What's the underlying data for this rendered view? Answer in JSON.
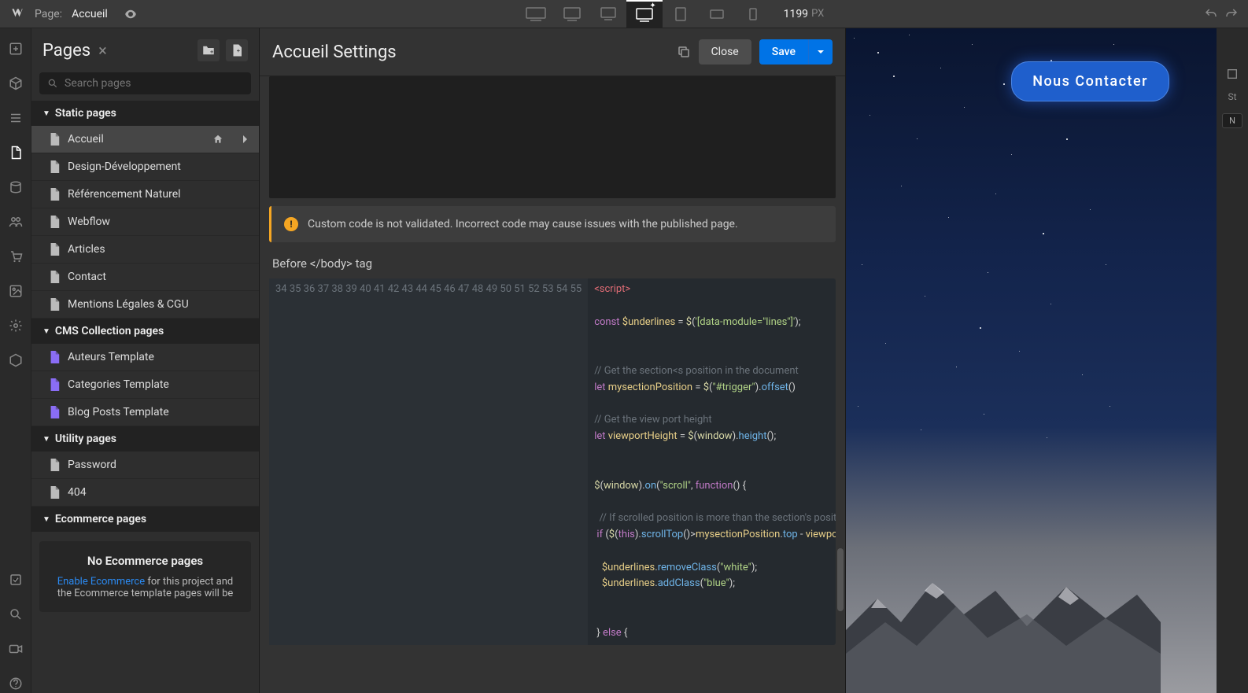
{
  "topbar": {
    "page_label": "Page:",
    "page_name": "Accueil",
    "width_value": "1199",
    "width_unit": "PX"
  },
  "pages_panel": {
    "title": "Pages",
    "search_placeholder": "Search pages",
    "sections": {
      "static": "Static pages",
      "cms": "CMS Collection pages",
      "utility": "Utility pages",
      "ecommerce": "Ecommerce pages"
    },
    "static_pages": [
      "Accueil",
      "Design-Développement",
      "Référencement Naturel",
      "Webflow",
      "Articles",
      "Contact",
      "Mentions Légales & CGU"
    ],
    "cms_pages": [
      "Auteurs Template",
      "Categories Template",
      "Blog Posts Template"
    ],
    "utility_pages": [
      "Password",
      "404"
    ],
    "ecommerce": {
      "empty_title": "No Ecommerce pages",
      "link_text": "Enable Ecommerce",
      "rest": " for this project and the Ecommerce template pages will be"
    }
  },
  "settings": {
    "title": "Accueil Settings",
    "close": "Close",
    "save": "Save",
    "warning_text": "Custom code is not validated. Incorrect code may cause issues with the published page.",
    "before_body_label": "Before </body> tag",
    "code_start_line": 34,
    "code_tokens": [
      [
        [
          "tag",
          "<script>"
        ]
      ],
      [],
      [
        [
          "keyword",
          "const"
        ],
        [
          "punct",
          " "
        ],
        [
          "var",
          "$underlines"
        ],
        [
          "punct",
          " = "
        ],
        [
          "builtin",
          "$"
        ],
        [
          "punct",
          "("
        ],
        [
          "string",
          "'[data-module=\"lines\"]'"
        ],
        [
          "punct",
          ");"
        ]
      ],
      [],
      [],
      [
        [
          "comment",
          "// Get the section<s position in the document"
        ]
      ],
      [
        [
          "keyword",
          "let"
        ],
        [
          "punct",
          " "
        ],
        [
          "var",
          "mysectionPosition"
        ],
        [
          "punct",
          " = "
        ],
        [
          "builtin",
          "$"
        ],
        [
          "punct",
          "("
        ],
        [
          "string",
          "\"#trigger\""
        ],
        [
          "punct",
          ")."
        ],
        [
          "method",
          "offset"
        ],
        [
          "punct",
          "()"
        ]
      ],
      [],
      [
        [
          "comment",
          "// Get the view port height"
        ]
      ],
      [
        [
          "keyword",
          "let"
        ],
        [
          "punct",
          " "
        ],
        [
          "var",
          "viewportHeight"
        ],
        [
          "punct",
          " = "
        ],
        [
          "builtin",
          "$"
        ],
        [
          "punct",
          "("
        ],
        [
          "builtin",
          "window"
        ],
        [
          "punct",
          ")."
        ],
        [
          "method",
          "height"
        ],
        [
          "punct",
          "();"
        ]
      ],
      [],
      [],
      [
        [
          "builtin",
          "$"
        ],
        [
          "punct",
          "("
        ],
        [
          "builtin",
          "window"
        ],
        [
          "punct",
          ")."
        ],
        [
          "method",
          "on"
        ],
        [
          "punct",
          "("
        ],
        [
          "string",
          "\"scroll\""
        ],
        [
          "punct",
          ", "
        ],
        [
          "keyword",
          "function"
        ],
        [
          "punct",
          "() {"
        ]
      ],
      [],
      [
        [
          "comment",
          "  // If scrolled position is more than the section's position MINUS the viewport height"
        ]
      ],
      [
        [
          "punct",
          " "
        ],
        [
          "keyword",
          "if"
        ],
        [
          "punct",
          " ("
        ],
        [
          "builtin",
          "$"
        ],
        [
          "punct",
          "("
        ],
        [
          "keyword",
          "this"
        ],
        [
          "punct",
          ")."
        ],
        [
          "method",
          "scrollTop"
        ],
        [
          "punct",
          "()>"
        ],
        [
          "var",
          "mysectionPosition"
        ],
        [
          "punct",
          "."
        ],
        [
          "method",
          "top"
        ],
        [
          "punct",
          " - "
        ],
        [
          "var",
          "viewportHeight"
        ],
        [
          "punct",
          ") {"
        ]
      ],
      [],
      [
        [
          "punct",
          "   "
        ],
        [
          "var",
          "$underlines"
        ],
        [
          "punct",
          "."
        ],
        [
          "method",
          "removeClass"
        ],
        [
          "punct",
          "("
        ],
        [
          "string",
          "\"white\""
        ],
        [
          "punct",
          ");"
        ]
      ],
      [
        [
          "punct",
          "   "
        ],
        [
          "var",
          "$underlines"
        ],
        [
          "punct",
          "."
        ],
        [
          "method",
          "addClass"
        ],
        [
          "punct",
          "("
        ],
        [
          "string",
          "\"blue\""
        ],
        [
          "punct",
          ");"
        ]
      ],
      [],
      [],
      [
        [
          "punct",
          " } "
        ],
        [
          "keyword",
          "else"
        ],
        [
          "punct",
          " {"
        ]
      ]
    ]
  },
  "canvas": {
    "cta_label": "Nous Contacter"
  },
  "right_rail": {
    "st_label": "St",
    "selector_value": "N"
  }
}
